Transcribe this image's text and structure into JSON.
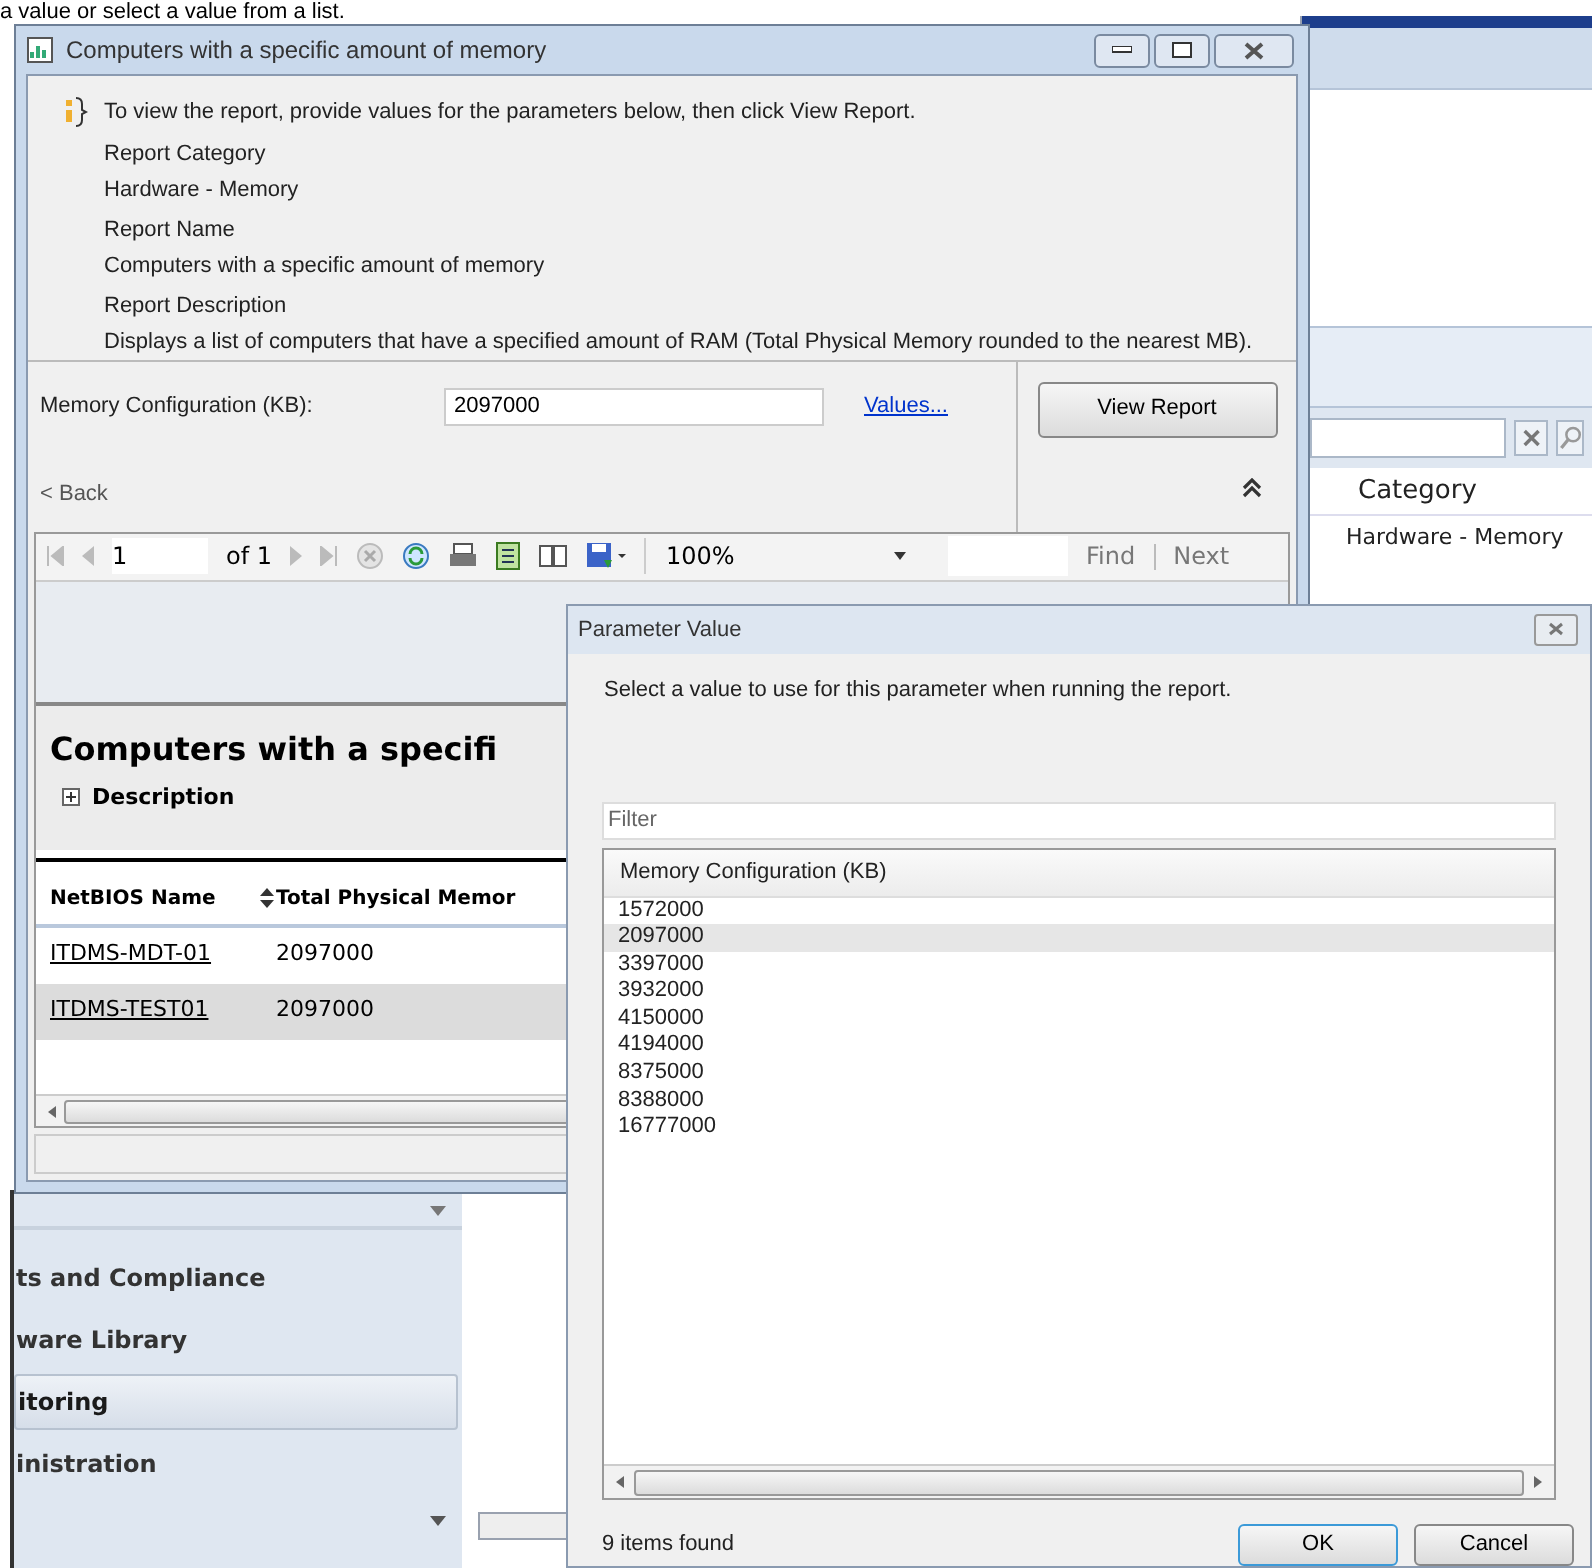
{
  "page_caption": "a value or select a value from a list.",
  "background_app": {
    "column": "Category",
    "row": "Hardware - Memory",
    "nav_items": [
      {
        "label": "ts and Compliance",
        "selected": false
      },
      {
        "label": "ware Library",
        "selected": false
      },
      {
        "label": "itoring",
        "selected": true
      },
      {
        "label": "inistration",
        "selected": false
      }
    ]
  },
  "report_window": {
    "title": "Computers with a specific amount of memory",
    "info": "To view the report, provide values for the parameters below, then click View Report.",
    "details": [
      {
        "label": "Report Category",
        "value": "Hardware - Memory"
      },
      {
        "label": "Report Name",
        "value": "Computers with a specific amount of memory"
      },
      {
        "label": "Report Description",
        "value": "Displays a list of computers that have a specified amount of RAM (Total Physical Memory rounded to the nearest MB)."
      }
    ],
    "parameter": {
      "label": "Memory Configuration (KB):",
      "value": "2097000",
      "values_link": "Values..."
    },
    "view_report_button": "View Report",
    "back_link": "< Back",
    "toolbar": {
      "page": "1",
      "page_count": "of 1",
      "zoom": "100%",
      "find": "Find",
      "next": "Next"
    },
    "report": {
      "title": "Computers with a specifi",
      "description": "Description",
      "columns": [
        "NetBIOS Name",
        "Total Physical Memor"
      ],
      "rows": [
        {
          "cells": [
            "ITDMS-MDT-01",
            "2097000"
          ]
        },
        {
          "cells": [
            "ITDMS-TEST01",
            "2097000"
          ]
        }
      ]
    }
  },
  "dialog": {
    "title": "Parameter Value",
    "instruction": "Select a value to use for this parameter when running the report.",
    "filter_placeholder": "Filter",
    "column": "Memory Configuration (KB)",
    "items": [
      {
        "label": "1572000",
        "selected": false
      },
      {
        "label": "2097000",
        "selected": true
      },
      {
        "label": "3397000",
        "selected": false
      },
      {
        "label": "3932000",
        "selected": false
      },
      {
        "label": "4150000",
        "selected": false
      },
      {
        "label": "4194000",
        "selected": false
      },
      {
        "label": "8375000",
        "selected": false
      },
      {
        "label": "8388000",
        "selected": false
      },
      {
        "label": "16777000",
        "selected": false
      }
    ],
    "status": "9 items found",
    "buttons": [
      "OK",
      "Cancel"
    ]
  }
}
